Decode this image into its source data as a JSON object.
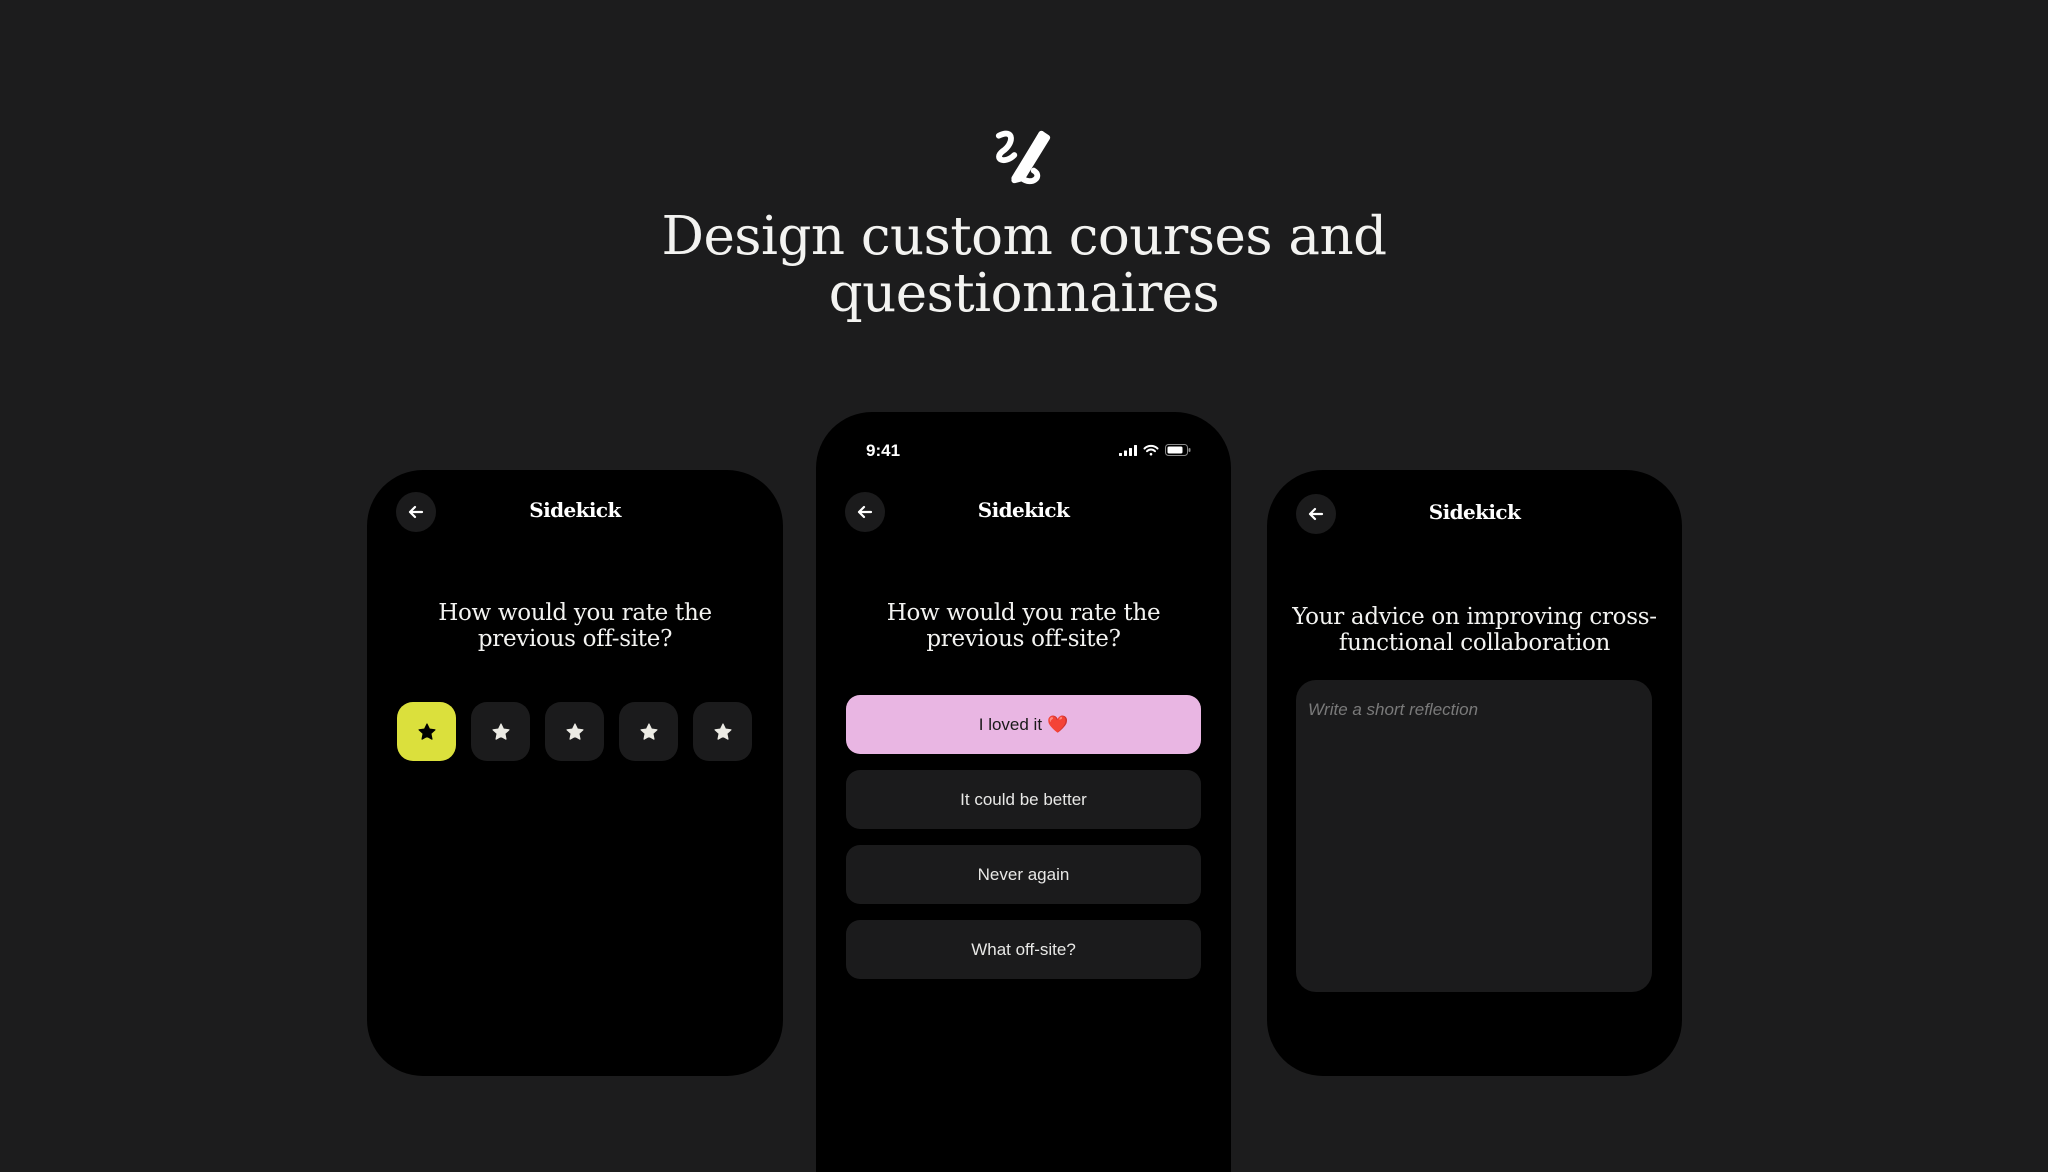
{
  "hero": {
    "icon": "pen-swirl-icon",
    "headline": "Design custom courses and questionnaires"
  },
  "left_phone": {
    "app_title": "Sidekick",
    "question": "How would you rate the previous off-site?",
    "rating": {
      "max": 5,
      "selected": 1,
      "accent": "#dbe03c"
    }
  },
  "center_phone": {
    "status_time": "9:41",
    "app_title": "Sidekick",
    "question": "How would you rate the previous off-site?",
    "options": [
      {
        "label": "I loved it",
        "emoji": "❤️",
        "selected": true
      },
      {
        "label": "It could be better",
        "selected": false
      },
      {
        "label": "Never again",
        "selected": false
      },
      {
        "label": "What off-site?",
        "selected": false
      }
    ],
    "accent": "#e9b6e3"
  },
  "right_phone": {
    "app_title": "Sidekick",
    "question": "Your advice on improving cross-functional collaboration",
    "reflection_placeholder": "Write a short reflection"
  },
  "colors": {
    "background": "#1c1c1d",
    "phone": "#000000",
    "surface": "#1b1b1c"
  }
}
